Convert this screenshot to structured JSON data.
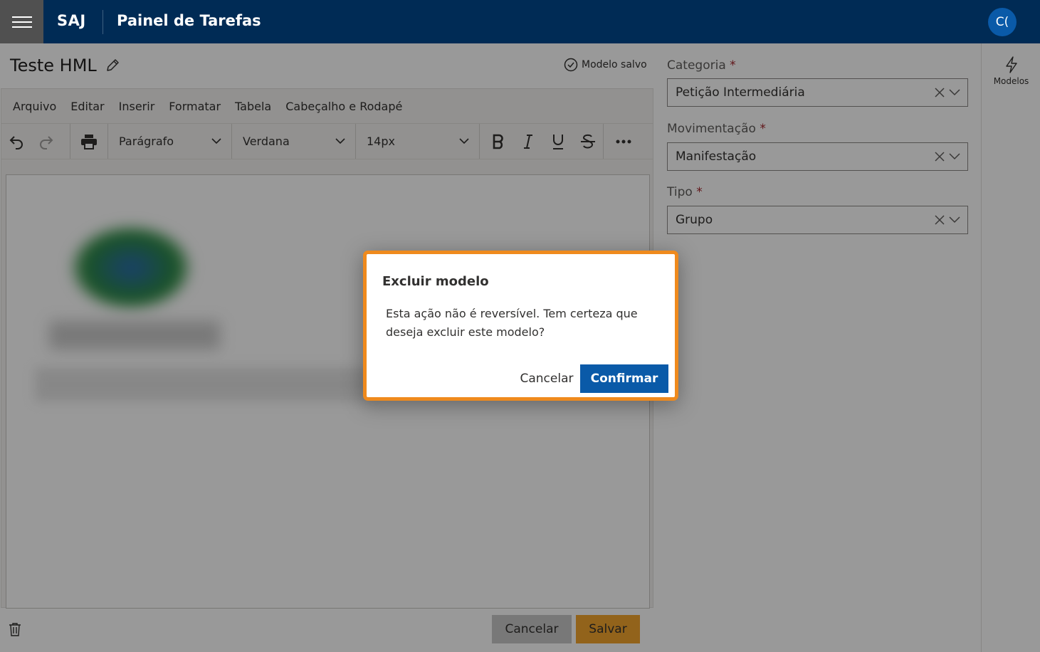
{
  "header": {
    "brand": "SAJ",
    "app_title": "Painel de Tarefas",
    "avatar_initials": "C("
  },
  "document": {
    "title": "Teste HML",
    "saved_status": "Modelo salvo"
  },
  "menu": {
    "items": [
      "Arquivo",
      "Editar",
      "Inserir",
      "Formatar",
      "Tabela",
      "Cabeçalho e Rodapé"
    ]
  },
  "toolbar": {
    "block_format": "Parágrafo",
    "font_family": "Verdana",
    "font_size": "14px"
  },
  "fields": {
    "categoria": {
      "label": "Categoria",
      "required_mark": "*",
      "value": "Petição Intermediária"
    },
    "movimentacao": {
      "label": "Movimentação",
      "required_mark": "*",
      "value": "Manifestação"
    },
    "tipo": {
      "label": "Tipo",
      "required_mark": "*",
      "value": "Grupo"
    }
  },
  "rail": {
    "models_label": "Modelos"
  },
  "footer": {
    "cancel_label": "Cancelar",
    "save_label": "Salvar"
  },
  "dialog": {
    "title": "Excluir modelo",
    "message": "Esta ação não é reversível. Tem certeza que deseja excluir este modelo?",
    "cancel_label": "Cancelar",
    "confirm_label": "Confirmar"
  },
  "colors": {
    "header_bg": "#002b55",
    "primary": "#0a5aa8",
    "save_button": "#f4a52d",
    "dialog_highlight": "#ef8a1d",
    "required": "#a4262c"
  },
  "icons": [
    "hamburger-icon",
    "pencil-icon",
    "check-circle-icon",
    "undo-icon",
    "redo-icon",
    "print-icon",
    "chevron-down-icon",
    "bold-icon",
    "italic-icon",
    "underline-icon",
    "strikethrough-icon",
    "more-icon",
    "clear-icon",
    "lightning-icon",
    "trash-icon"
  ]
}
